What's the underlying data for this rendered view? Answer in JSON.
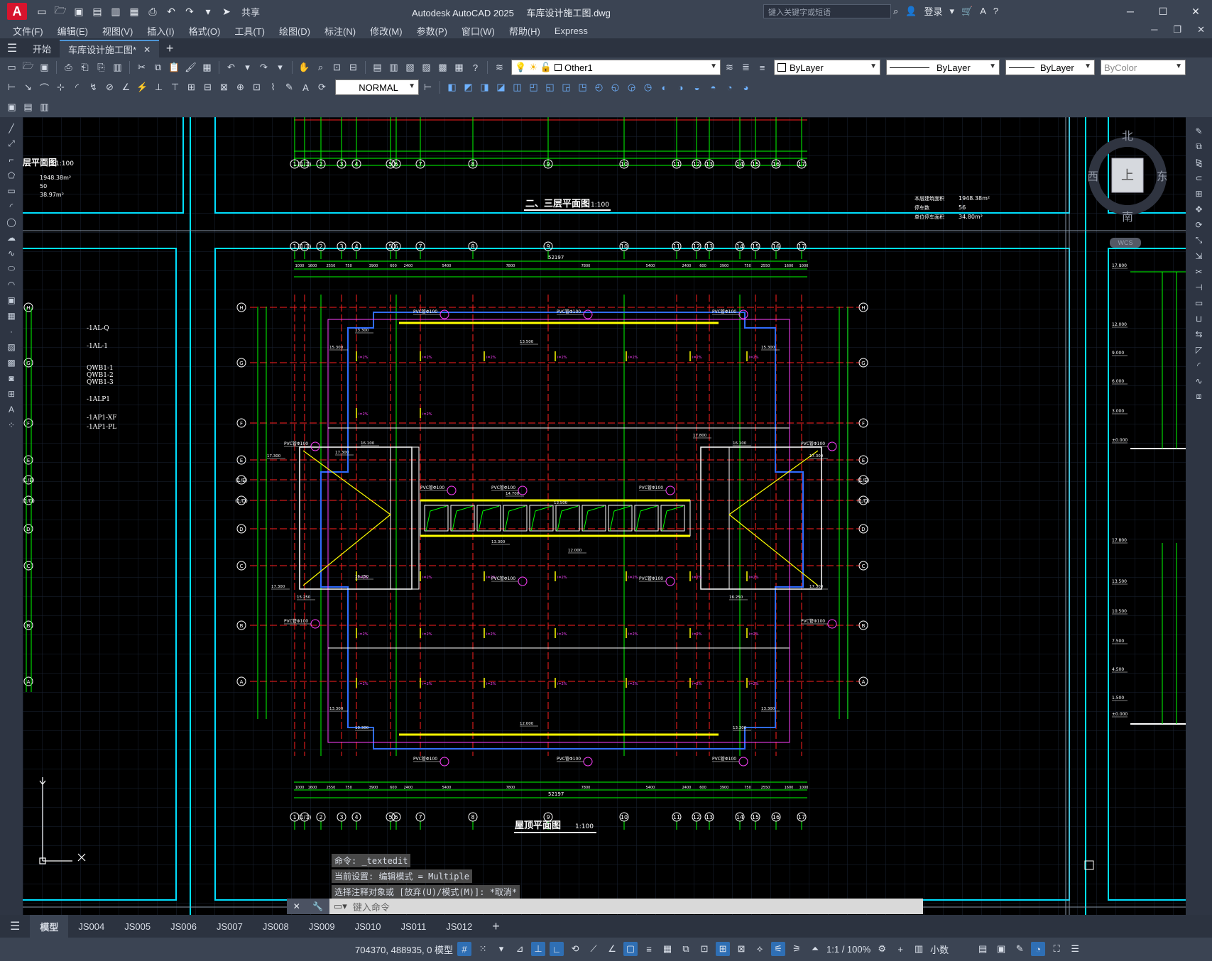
{
  "app": {
    "logo_letter": "A",
    "title_app": "Autodesk AutoCAD 2025",
    "title_file": "车库设计施工图.dwg",
    "share_label": "共享",
    "search_placeholder": "键入关键字或短语",
    "signin_label": "登录"
  },
  "menu": [
    "文件(F)",
    "编辑(E)",
    "视图(V)",
    "插入(I)",
    "格式(O)",
    "工具(T)",
    "绘图(D)",
    "标注(N)",
    "修改(M)",
    "参数(P)",
    "窗口(W)",
    "帮助(H)",
    "Express"
  ],
  "file_tabs": {
    "start": "开始",
    "current": "车库设计施工图*"
  },
  "toolbar": {
    "layer_name": "Other1",
    "color": "ByLayer",
    "linetype": "ByLayer",
    "lineweight": "ByLayer",
    "plotstyle": "ByColor",
    "dim_style": "NORMAL"
  },
  "drawing": {
    "title_top": "二、三层平面图",
    "scale_top": "1:100",
    "title_main": "屋顶平面图",
    "scale_main": "1:100",
    "title_left": "层平面图",
    "scale_left": "1:100",
    "left_area_value1": "1948.38m²",
    "left_area_value2": "50",
    "left_area_value3": "38.97m²",
    "right_label1": "本层建筑面积",
    "right_value1": "1948.38m²",
    "right_label2": "停车数",
    "right_value2": "56",
    "right_label3": "单位停车面积",
    "right_value3": "34.80m²",
    "total_dim": "52197",
    "legend_items": [
      "-1AL-Q",
      "-1AL-1",
      "QWB1-1",
      "QWB1-2",
      "QWB1-3",
      "-1ALP1",
      "-1AP1-XF",
      "-1AP1-PL"
    ],
    "axis_numbers": [
      "1",
      "(1/1)",
      "2",
      "3",
      "4",
      "5",
      "6",
      "7",
      "8",
      "9",
      "10",
      "11",
      "12",
      "13",
      "14",
      "15",
      "16",
      "17"
    ],
    "axis_letters": [
      "H",
      "G",
      "F",
      "E",
      "(1/E)",
      "(1/D)",
      "D",
      "C",
      "B",
      "A"
    ],
    "pipe_label": "PVC管Φ100",
    "slope_label": "i=2%",
    "elev_labels": [
      "13.300",
      "13.500",
      "15.300",
      "16.100",
      "17.300",
      "17.800",
      "12.000",
      "14.700",
      "15.250",
      "16.250"
    ],
    "dims_top": [
      "1000",
      "1600",
      "2550",
      "750",
      "3900",
      "600",
      "2400",
      "5400",
      "7800",
      "7800",
      "5400",
      "2400",
      "600",
      "3900",
      "750",
      "2550",
      "1600",
      "1000"
    ],
    "right_elevs": [
      "17.800",
      "12.000",
      "9.000",
      "6.000",
      "3.000",
      "±0.000",
      "17.800",
      "13.500",
      "10.500",
      "7.500",
      "4.500",
      "1.500",
      "±0.000"
    ]
  },
  "viewcube": {
    "north": "北",
    "south": "南",
    "east": "东",
    "west": "西",
    "face": "上",
    "ucs": "WCS"
  },
  "command": {
    "line1": "命令: _textedit",
    "line2": "当前设置: 编辑模式 = Multiple",
    "line3": "选择注释对象或 [放弃(U)/模式(M)]: *取消*",
    "input_placeholder": "键入命令"
  },
  "layout_tabs": [
    "模型",
    "JS004",
    "JS005",
    "JS006",
    "JS007",
    "JS008",
    "JS009",
    "JS010",
    "JS011",
    "JS012"
  ],
  "status": {
    "coords": "704370, 488935, 0",
    "model": "模型",
    "scale": "1:1 / 100%",
    "units": "小数"
  }
}
